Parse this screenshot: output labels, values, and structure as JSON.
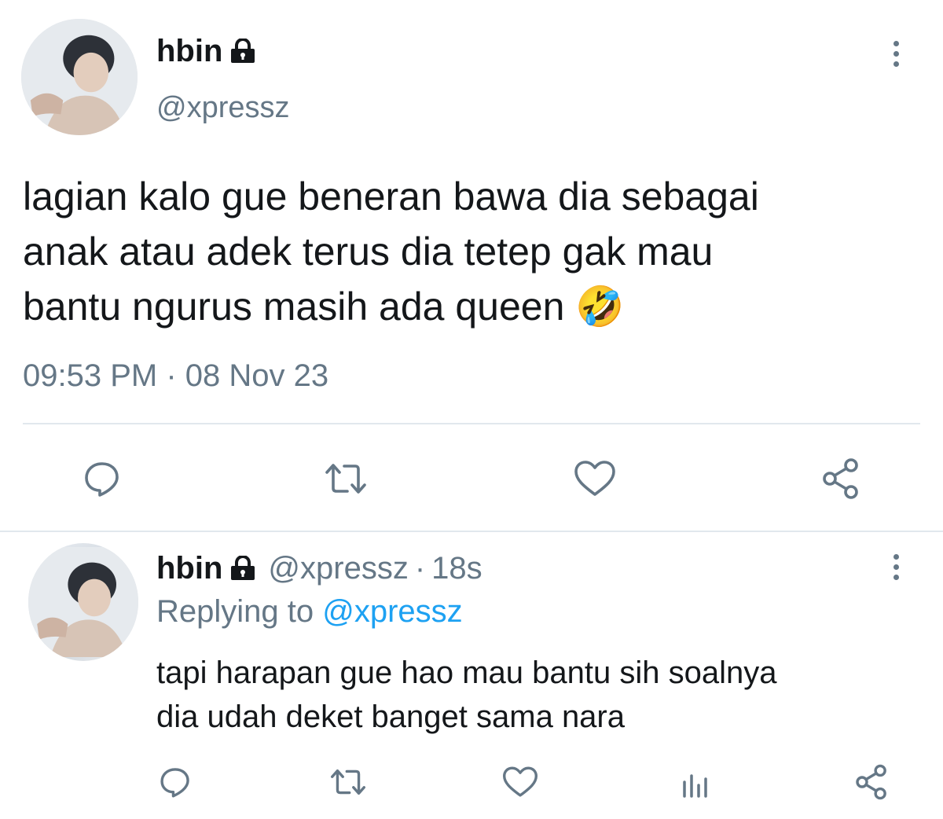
{
  "main_tweet": {
    "display_name": "hbin",
    "handle": "@xpressz",
    "text_lines": [
      "lagian kalo gue beneran bawa dia sebagai",
      "anak atau adek terus dia tetep gak mau",
      "bantu ngurus masih ada queen 🤣"
    ],
    "timestamp": "09:53 PM · 08 Nov 23",
    "icons": {
      "lock": "lock-icon",
      "menu": "more-vertical-icon",
      "reply": "reply-icon",
      "retweet": "retweet-icon",
      "like": "heart-icon",
      "share": "share-icon"
    }
  },
  "reply_tweet": {
    "display_name": "hbin",
    "handle": "@xpressz",
    "separator": "·",
    "time_ago": "18s",
    "replying_prefix": "Replying to",
    "replying_to": "@xpressz",
    "text_lines": [
      "tapi harapan gue hao mau bantu sih soalnya",
      "dia udah deket banget sama nara"
    ],
    "icons": {
      "reply": "reply-icon",
      "retweet": "retweet-icon",
      "like": "heart-icon",
      "analytics": "analytics-icon",
      "share": "share-icon"
    }
  },
  "colors": {
    "text": "#14171a",
    "muted": "#657786",
    "link": "#1da1f2",
    "divider": "#e1e8ed"
  }
}
